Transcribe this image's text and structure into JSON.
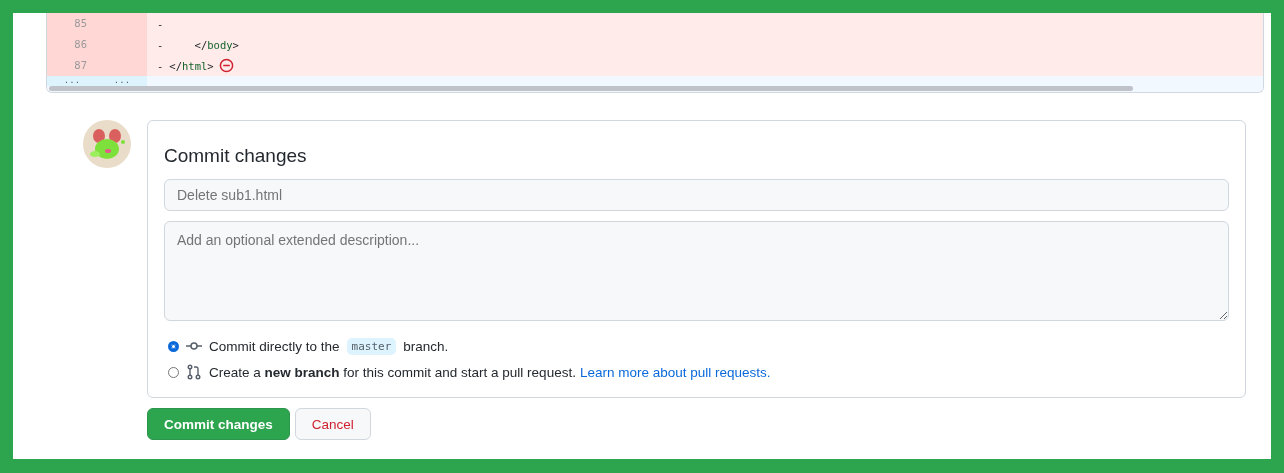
{
  "diff": {
    "lines": [
      {
        "old": "85",
        "marker": "-",
        "no_newline": false
      },
      {
        "old": "86",
        "marker": "-",
        "tokens": [
          {
            "kind": "text",
            "text": "    </"
          },
          {
            "kind": "tag",
            "text": "body"
          },
          {
            "kind": "text",
            "text": ">"
          }
        ],
        "no_newline": false
      },
      {
        "old": "87",
        "marker": "-",
        "tokens": [
          {
            "kind": "text",
            "text": "</"
          },
          {
            "kind": "tag",
            "text": "html"
          },
          {
            "kind": "text",
            "text": ">"
          }
        ],
        "no_newline": true
      }
    ],
    "expander": [
      "...",
      "..."
    ]
  },
  "commit": {
    "title": "Commit changes",
    "summary": {
      "placeholder": "Delete sub1.html"
    },
    "description": {
      "placeholder": "Add an optional extended description..."
    },
    "options": [
      {
        "kind": "direct",
        "selected": true,
        "before": "Commit directly to the",
        "branch": "master",
        "after": "branch."
      },
      {
        "kind": "new_branch",
        "selected": false,
        "text": "Create a **new branch** for this commit and start a pull request.",
        "link": "Learn more about pull requests."
      }
    ]
  },
  "buttons": [
    {
      "kind": "primary",
      "label": "Commit changes"
    },
    {
      "kind": "cancel",
      "label": "Cancel"
    }
  ]
}
